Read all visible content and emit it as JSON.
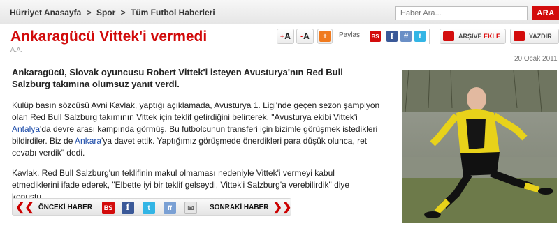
{
  "breadcrumb": {
    "items": [
      "Hürriyet Anasayfa",
      "Spor",
      "Tüm Futbol Haberleri"
    ],
    "separator": ">"
  },
  "search": {
    "placeholder": "Haber Ara...",
    "button_label": "ARA"
  },
  "article": {
    "title": "Ankaragücü Vittek'i vermedi",
    "source": "A.A.",
    "date": "20 Ocak 2011",
    "lead": "Ankaragücü, Slovak oyuncusu Robert Vittek'i isteyen Avusturya'nın Red Bull Salzburg takımına olumsuz yanıt verdi.",
    "p1_a": "Kulüp basın sözcüsü Avni Kavlak, yaptığı açıklamada, Avusturya 1. Ligi'nde geçen sezon şampiyon olan Red Bull Salzburg takımının Vittek için teklif getirdiğini belirterek, \"Avusturya ekibi Vittek'i ",
    "p1_link1": "Antalya",
    "p1_b": "'da devre arası kampında görmüş. Bu futbolcunun transferi için bizimle görüşmek istedikleri bildirdiler. Biz de ",
    "p1_link2": "Ankara",
    "p1_c": "'ya davet ettik. Yaptığımız görüşmede önerdikleri para düşük olunca, ret cevabı verdik\" dedi.",
    "p2": "Kavlak, Red Bull Salzburg'un teklifinin makul olmaması nedeniyle Vittek'i vermeyi kabul etmediklerini ifade ederek, \"Elbette iyi bir teklif gelseydi, Vittek'i Salzburg'a verebilirdik\" diye konuştu."
  },
  "toolbar": {
    "font_increase": "A",
    "font_decrease": "A",
    "font_increase_sign": "+",
    "font_decrease_sign": "-",
    "share_label": "Paylaş",
    "archive_label": "ARŞİVE",
    "archive_add": "EKLE",
    "print_label": "YAZDIR",
    "icons": [
      "plus-icon",
      "bs-icon",
      "facebook-icon",
      "friendfeed-icon",
      "twitter-icon",
      "archive-icon",
      "print-icon"
    ]
  },
  "bottom_nav": {
    "prev_label": "ÖNCEKİ HABER",
    "next_label": "SONRAKİ HABER",
    "bs_label": "BS",
    "icons": [
      "bs-icon",
      "facebook-icon",
      "twitter-icon",
      "friendfeed-icon",
      "email-icon"
    ]
  },
  "colors": {
    "accent": "#d10a0a",
    "link": "#1a4aa8",
    "facebook": "#3b5998",
    "twitter": "#33b5e5"
  }
}
